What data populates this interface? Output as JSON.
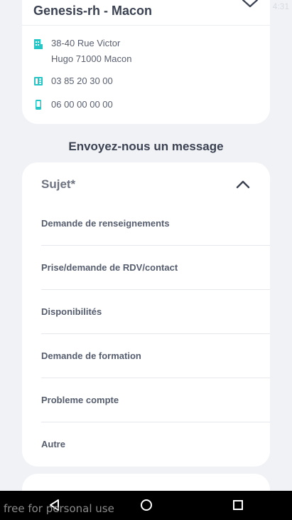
{
  "status": {
    "time": "4:31"
  },
  "agency": {
    "name": "Genesis-rh - Macon",
    "address_line1": "38-40 Rue Victor",
    "address_line2": "Hugo 71000 Macon",
    "phone": "03 85 20 30 00",
    "mobile": "06 00 00 00 00"
  },
  "message_section": {
    "title": "Envoyez-nous un message"
  },
  "subject": {
    "label": "Sujet*",
    "options": [
      "Demande de renseignements",
      "Prise/demande de RDV/contact",
      "Disponibilités",
      "Demande de formation",
      "Probleme compte",
      "Autre"
    ]
  },
  "watermark": "free for personal use",
  "colors": {
    "accent": "#27c6c6",
    "card": "#ffffff",
    "background": "#f1f2f6"
  },
  "icons": [
    "chevron-down-icon",
    "building-icon",
    "phone-icon",
    "mobile-icon",
    "chevron-up-icon",
    "nav-back-icon",
    "nav-home-icon",
    "nav-recents-icon"
  ]
}
